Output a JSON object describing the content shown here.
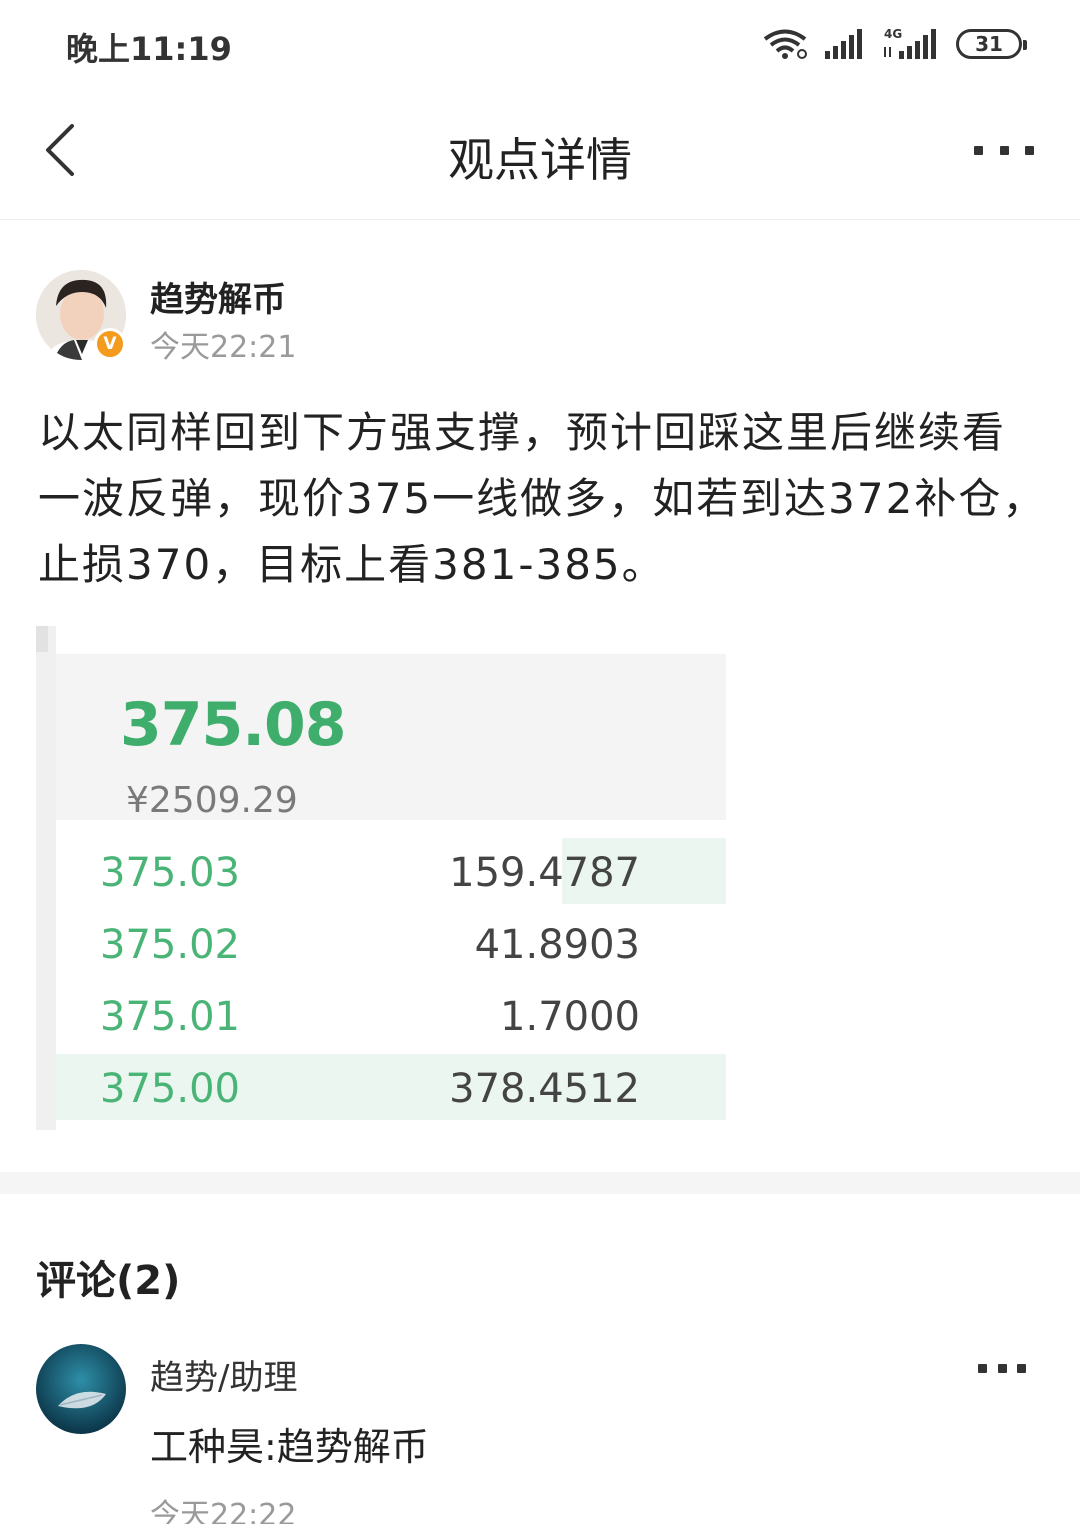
{
  "status_bar": {
    "time": "晚上11:19",
    "network": "4G",
    "battery": "31"
  },
  "header": {
    "title": "观点详情"
  },
  "post": {
    "author": "趋势解币",
    "time": "今天22:21",
    "verified_badge": "V",
    "text": "以太同样回到下方强支撑，预计回踩这里后继续看一波反弹，现价375一线做多，如若到达372补仓，止损370，目标上看381-385。",
    "image": {
      "price": "375.08",
      "cny": "¥2509.29",
      "rows": [
        {
          "price": "375.03",
          "qty": "159.4787"
        },
        {
          "price": "375.02",
          "qty": "41.8903"
        },
        {
          "price": "375.01",
          "qty": "1.7000"
        },
        {
          "price": "375.00",
          "qty": "378.4512"
        }
      ]
    }
  },
  "comments": {
    "title": "评论(2)",
    "items": [
      {
        "author": "趋势/助理",
        "text": "工种昊:趋势解币",
        "time": "今天22:22"
      }
    ]
  },
  "colors": {
    "accent_green": "#3fae6c",
    "badge_orange": "#f49b1e",
    "muted_gray": "#9a9a9a"
  }
}
